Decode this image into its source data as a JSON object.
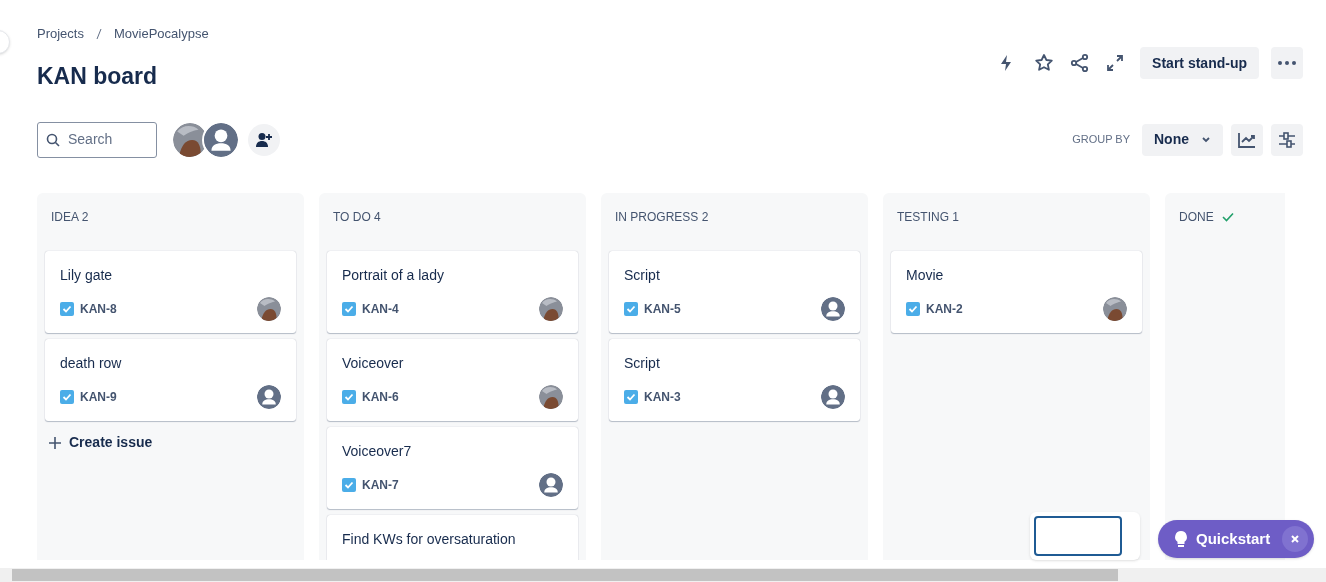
{
  "breadcrumbs": [
    "Projects",
    "MoviePocalypse"
  ],
  "title": "KAN board",
  "header": {
    "standup_button": "Start stand-up"
  },
  "toolbar": {
    "search": {
      "placeholder": "Search"
    },
    "avatars": [
      {
        "kind": "photo"
      },
      {
        "kind": "default"
      }
    ],
    "group_by": {
      "label": "GROUP BY",
      "value": "None"
    }
  },
  "columns": [
    {
      "name": "IDEA 2",
      "done": false,
      "create_issue": "Create issue",
      "cards": [
        {
          "title": "Lily gate",
          "key": "KAN-8",
          "assignee": {
            "kind": "photo"
          }
        },
        {
          "title": "death row",
          "key": "KAN-9",
          "assignee": {
            "kind": "default"
          }
        }
      ]
    },
    {
      "name": "TO DO 4",
      "done": false,
      "cards": [
        {
          "title": "Portrait of a lady",
          "key": "KAN-4",
          "assignee": {
            "kind": "photo"
          }
        },
        {
          "title": "Voiceover",
          "key": "KAN-6",
          "assignee": {
            "kind": "photo"
          }
        },
        {
          "title": "Voiceover7",
          "key": "KAN-7",
          "assignee": {
            "kind": "default"
          }
        },
        {
          "title": "Find KWs for oversaturation"
        }
      ]
    },
    {
      "name": "IN PROGRESS 2",
      "done": false,
      "cards": [
        {
          "title": "Script",
          "key": "KAN-5",
          "assignee": {
            "kind": "default"
          }
        },
        {
          "title": "Script",
          "key": "KAN-3",
          "assignee": {
            "kind": "default"
          }
        }
      ]
    },
    {
      "name": "TESTING 1",
      "done": false,
      "cards": [
        {
          "title": "Movie",
          "key": "KAN-2",
          "assignee": {
            "kind": "photo"
          }
        }
      ]
    },
    {
      "name": "DONE",
      "done": true
    }
  ],
  "quickstart": {
    "label": "Quickstart"
  }
}
